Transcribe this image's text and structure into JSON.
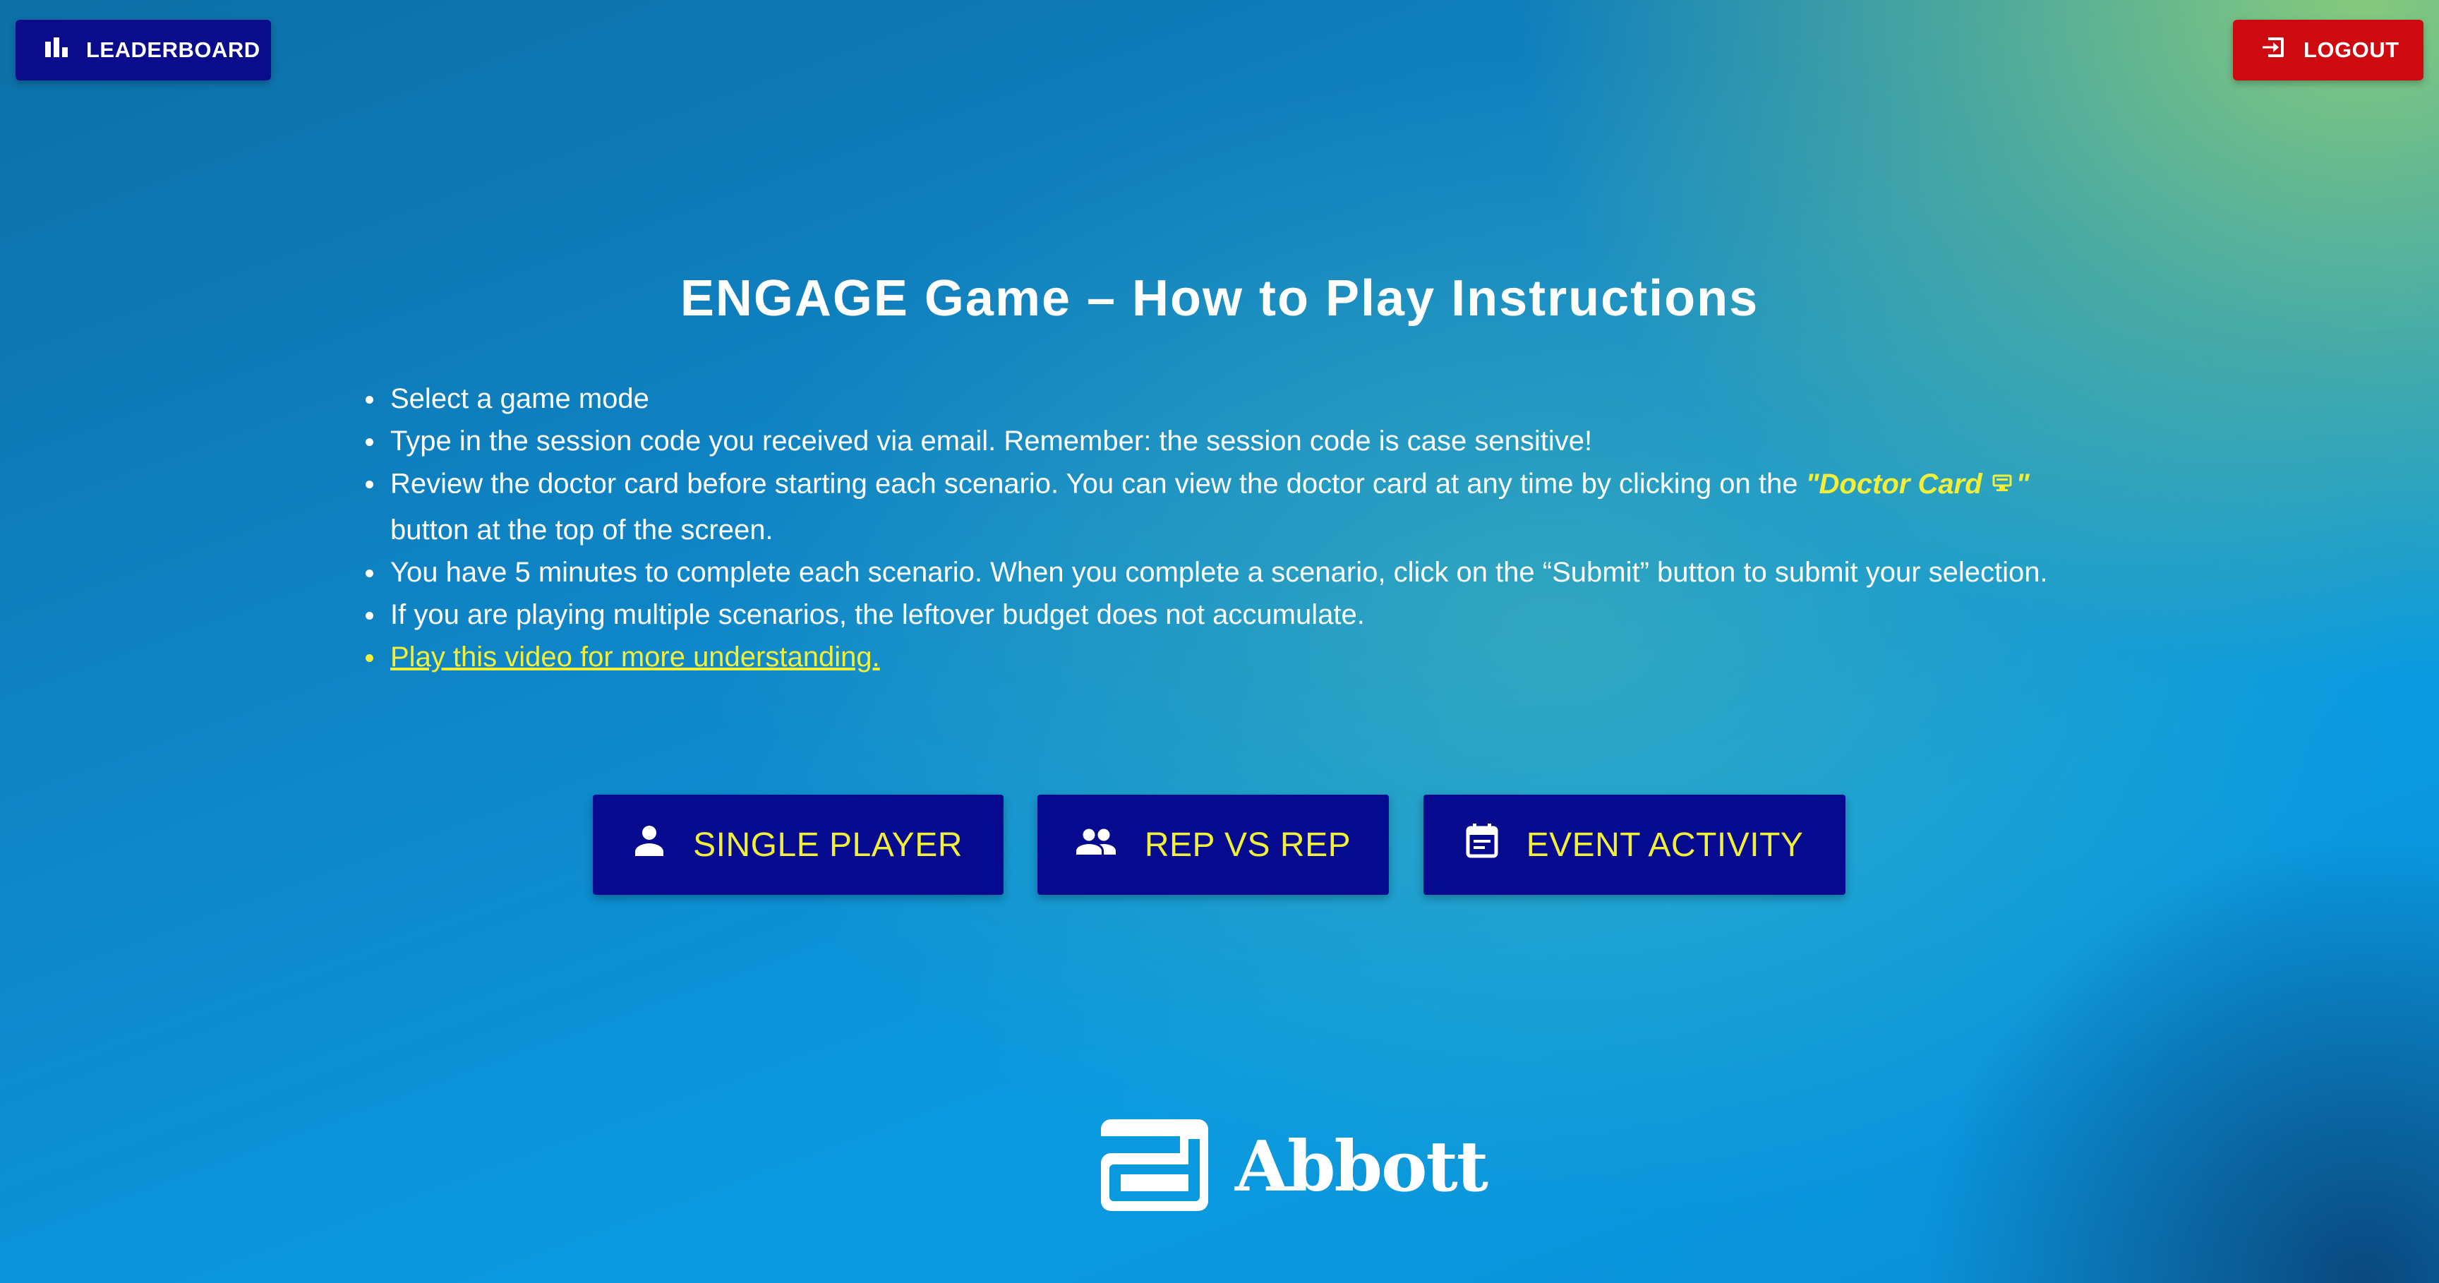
{
  "header": {
    "leaderboard_label": "LEADERBOARD",
    "leaderboard_icon": "bar-chart-icon",
    "logout_label": "LOGOUT",
    "logout_icon": "logout-icon"
  },
  "main": {
    "title": "ENGAGE Game – How to Play Instructions",
    "instructions": [
      "Select a game mode",
      "Type in the session code you received via email. Remember: the session code is case sensitive!",
      "Review the doctor card before starting each scenario. You can view the doctor card at any time by clicking on the",
      "You have 5 minutes to complete each scenario. When you complete a scenario, click on the “Submit” button to submit your selection.",
      "If you are playing multiple scenarios, the leftover budget does not accumulate."
    ],
    "doctor_card_ref": "\"Doctor Card",
    "doctor_card_ref_end": "\"",
    "instruction_3_cont": "button at the top of the screen.",
    "video_link": "Play this video for more understanding."
  },
  "modes": [
    {
      "label": "SINGLE PLAYER",
      "icon": "person-icon"
    },
    {
      "label": "REP VS REP",
      "icon": "group-icon"
    },
    {
      "label": "EVENT ACTIVITY",
      "icon": "calendar-icon"
    }
  ],
  "footer": {
    "logo_text": "Abbott"
  },
  "colors": {
    "navy_button": "#060a8e",
    "logout_red": "#cc0a10",
    "accent_yellow": "#f2ef3a",
    "text_white": "#ffffff"
  }
}
